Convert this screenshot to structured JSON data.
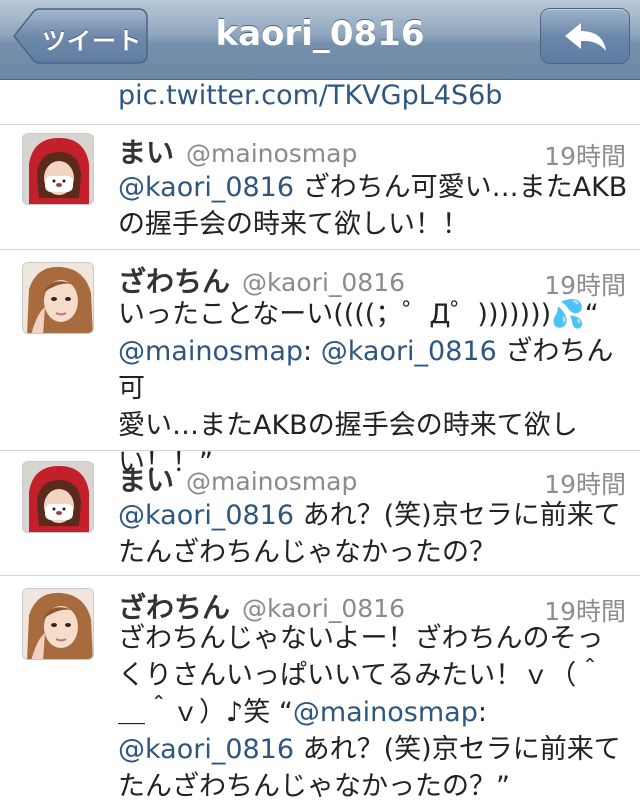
{
  "nav": {
    "back_label": "ツイート",
    "title": "kaori_0816",
    "reply_icon": "reply-arrow-icon"
  },
  "previous_tweet_link": "pic.twitter.com/TKVGpL4S6b",
  "tweets": [
    {
      "name": "まい",
      "handle": "@mainosmap",
      "time": "19時間",
      "lines": [
        "@kaori_0816 ざわちん可愛い…またAKB",
        "の握手会の時来て欲しい！！"
      ],
      "avatar": "mai"
    },
    {
      "name": "ざわちん",
      "handle": "@kaori_0816",
      "time": "19時間",
      "lines": [
        "いったことなーい((((；゜Д゜)))))))💦“",
        "@mainosmap: @kaori_0816 ざわちん可",
        "愛い…またAKBの握手会の時来て欲し",
        "い！！”"
      ],
      "avatar": "zawachin"
    },
    {
      "name": "まい",
      "handle": "@mainosmap",
      "time": "19時間",
      "lines": [
        "@kaori_0816 あれ？(笑)京セラに前来て",
        "たんざわちんじゃなかったの？"
      ],
      "avatar": "mai"
    },
    {
      "name": "ざわちん",
      "handle": "@kaori_0816",
      "time": "19時間",
      "lines": [
        "ざわちんじゃないよー！ざわちんのそっ",
        "くりさんいっぱいいてるみたい！ｖ（＾",
        "＿＾ｖ）♪笑 “@mainosmap:",
        "@kaori_0816 あれ？(笑)京セラに前来て",
        "たんざわちんじゃなかったの？”"
      ],
      "avatar": "zawachin"
    }
  ]
}
